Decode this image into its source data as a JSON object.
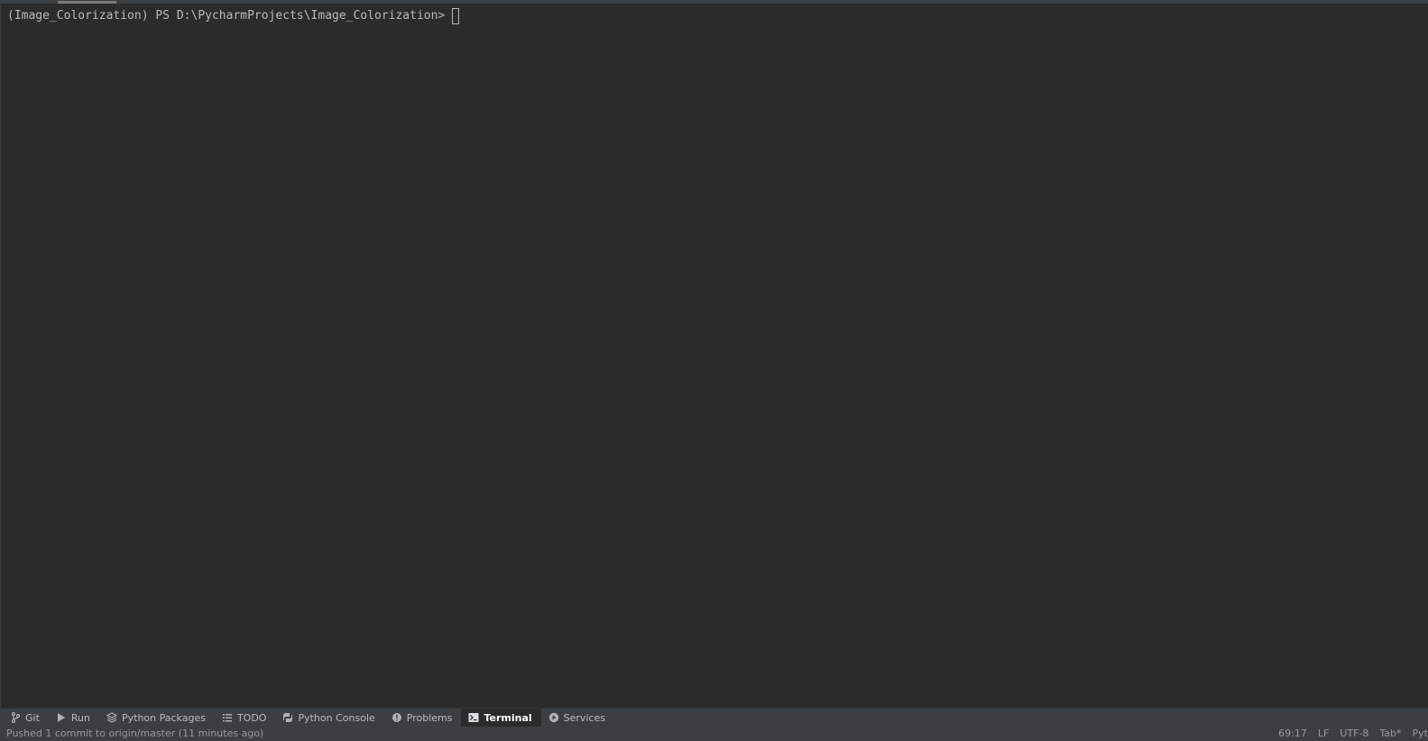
{
  "terminal": {
    "prompt": "(Image_Colorization) PS D:\\PycharmProjects\\Image_Colorization>"
  },
  "tool_tabs": [
    {
      "label": "Git",
      "icon": "git-branch-icon"
    },
    {
      "label": "Run",
      "icon": "run-icon"
    },
    {
      "label": "Python Packages",
      "icon": "packages-icon"
    },
    {
      "label": "TODO",
      "icon": "todo-list-icon"
    },
    {
      "label": "Python Console",
      "icon": "python-console-icon"
    },
    {
      "label": "Problems",
      "icon": "problems-icon"
    },
    {
      "label": "Terminal",
      "icon": "terminal-icon",
      "active": true
    },
    {
      "label": "Services",
      "icon": "services-icon"
    }
  ],
  "status": {
    "message": "Pushed 1 commit to origin/master (11 minutes ago)",
    "position": "69:17",
    "line_separator": "LF",
    "encoding": "UTF-8",
    "indent": "Tab*",
    "interpreter": "Pyt"
  },
  "colors": {
    "background": "#2b2b2b",
    "panel": "#3c3f41",
    "text": "#bbbbbb",
    "active_text": "#ffffff"
  }
}
